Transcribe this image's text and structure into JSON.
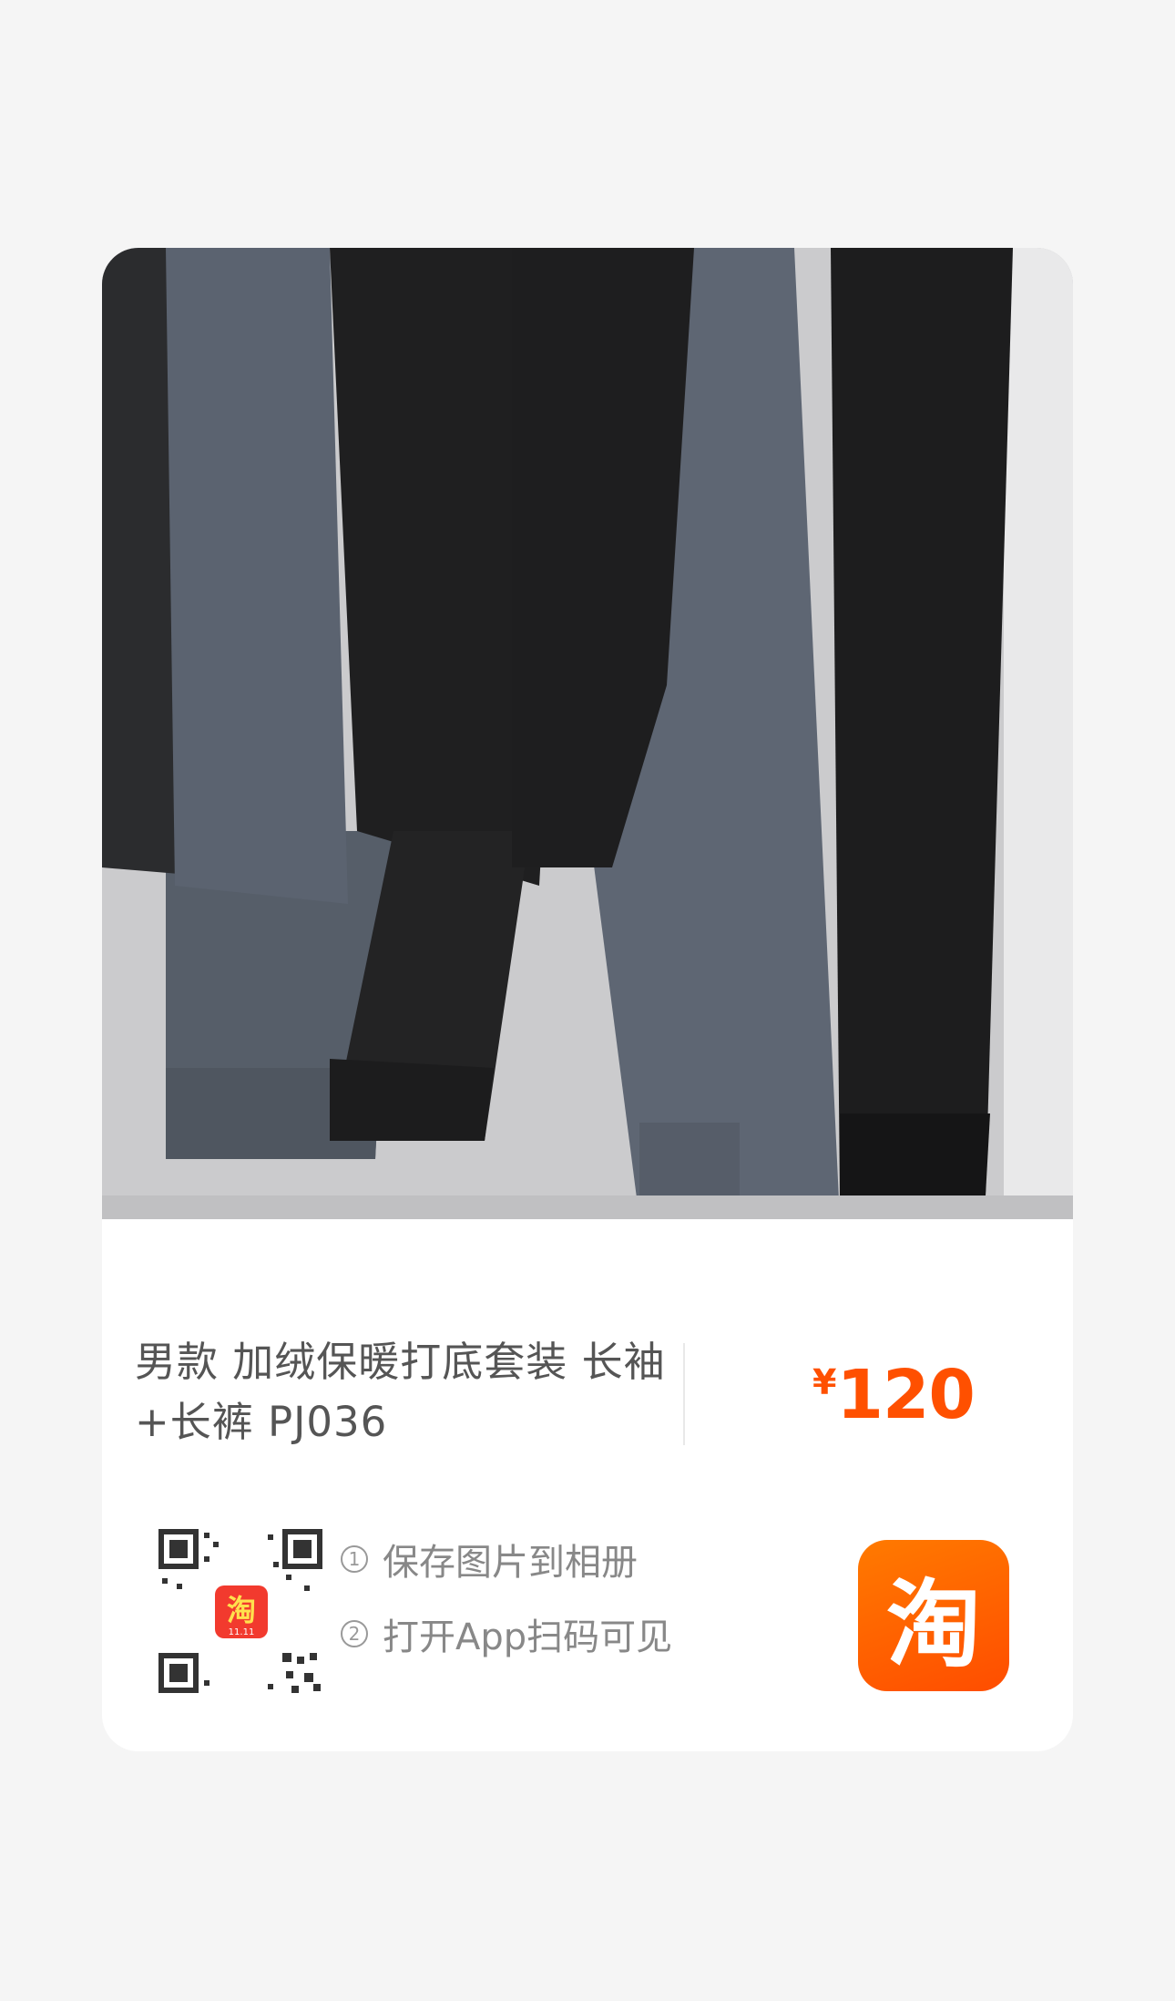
{
  "product": {
    "title": "男款 加绒保暖打底套装 长袖+长裤 PJ036",
    "currency_symbol": "¥",
    "price": "120"
  },
  "qr": {
    "badge_text": "淘",
    "badge_subtext": "11.11"
  },
  "steps": [
    {
      "num": "1",
      "label": "保存图片到相册"
    },
    {
      "num": "2",
      "label": "打开App扫码可见"
    }
  ],
  "brand": {
    "logo_text": "淘",
    "accent_color": "#ff5000"
  }
}
